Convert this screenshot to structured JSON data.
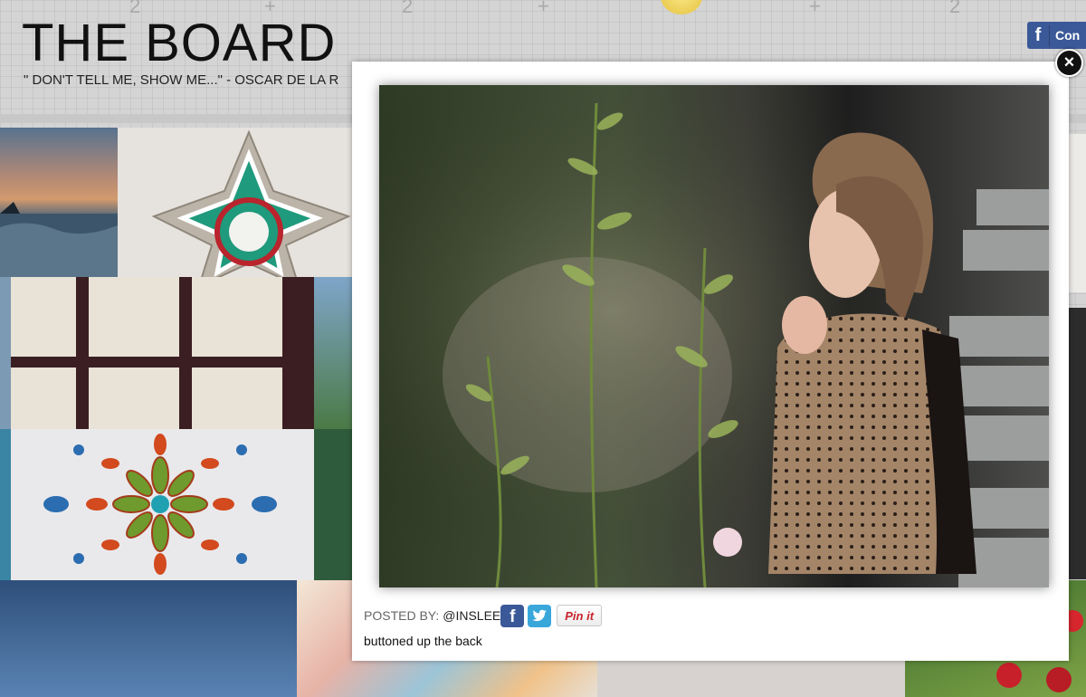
{
  "header": {
    "title": "THE BOARD",
    "tagline": "\" DON'T TELL ME, SHOW ME...\" - OSCAR DE LA R",
    "ruler_marks": [
      "2",
      "+",
      "2",
      "+",
      "+",
      "2"
    ],
    "connect_label": "Con"
  },
  "modal": {
    "posted_label": "POSTED BY:",
    "posted_user": "@INSLEE",
    "pin_label": "Pin it",
    "caption": "buttoned up the back",
    "close_symbol": "×"
  },
  "icons": {
    "facebook": "facebook-icon",
    "twitter": "twitter-icon",
    "close": "close-icon"
  },
  "colors": {
    "facebook": "#3b5998",
    "twitter": "#3aa7db",
    "pinterest": "#c8232c"
  }
}
